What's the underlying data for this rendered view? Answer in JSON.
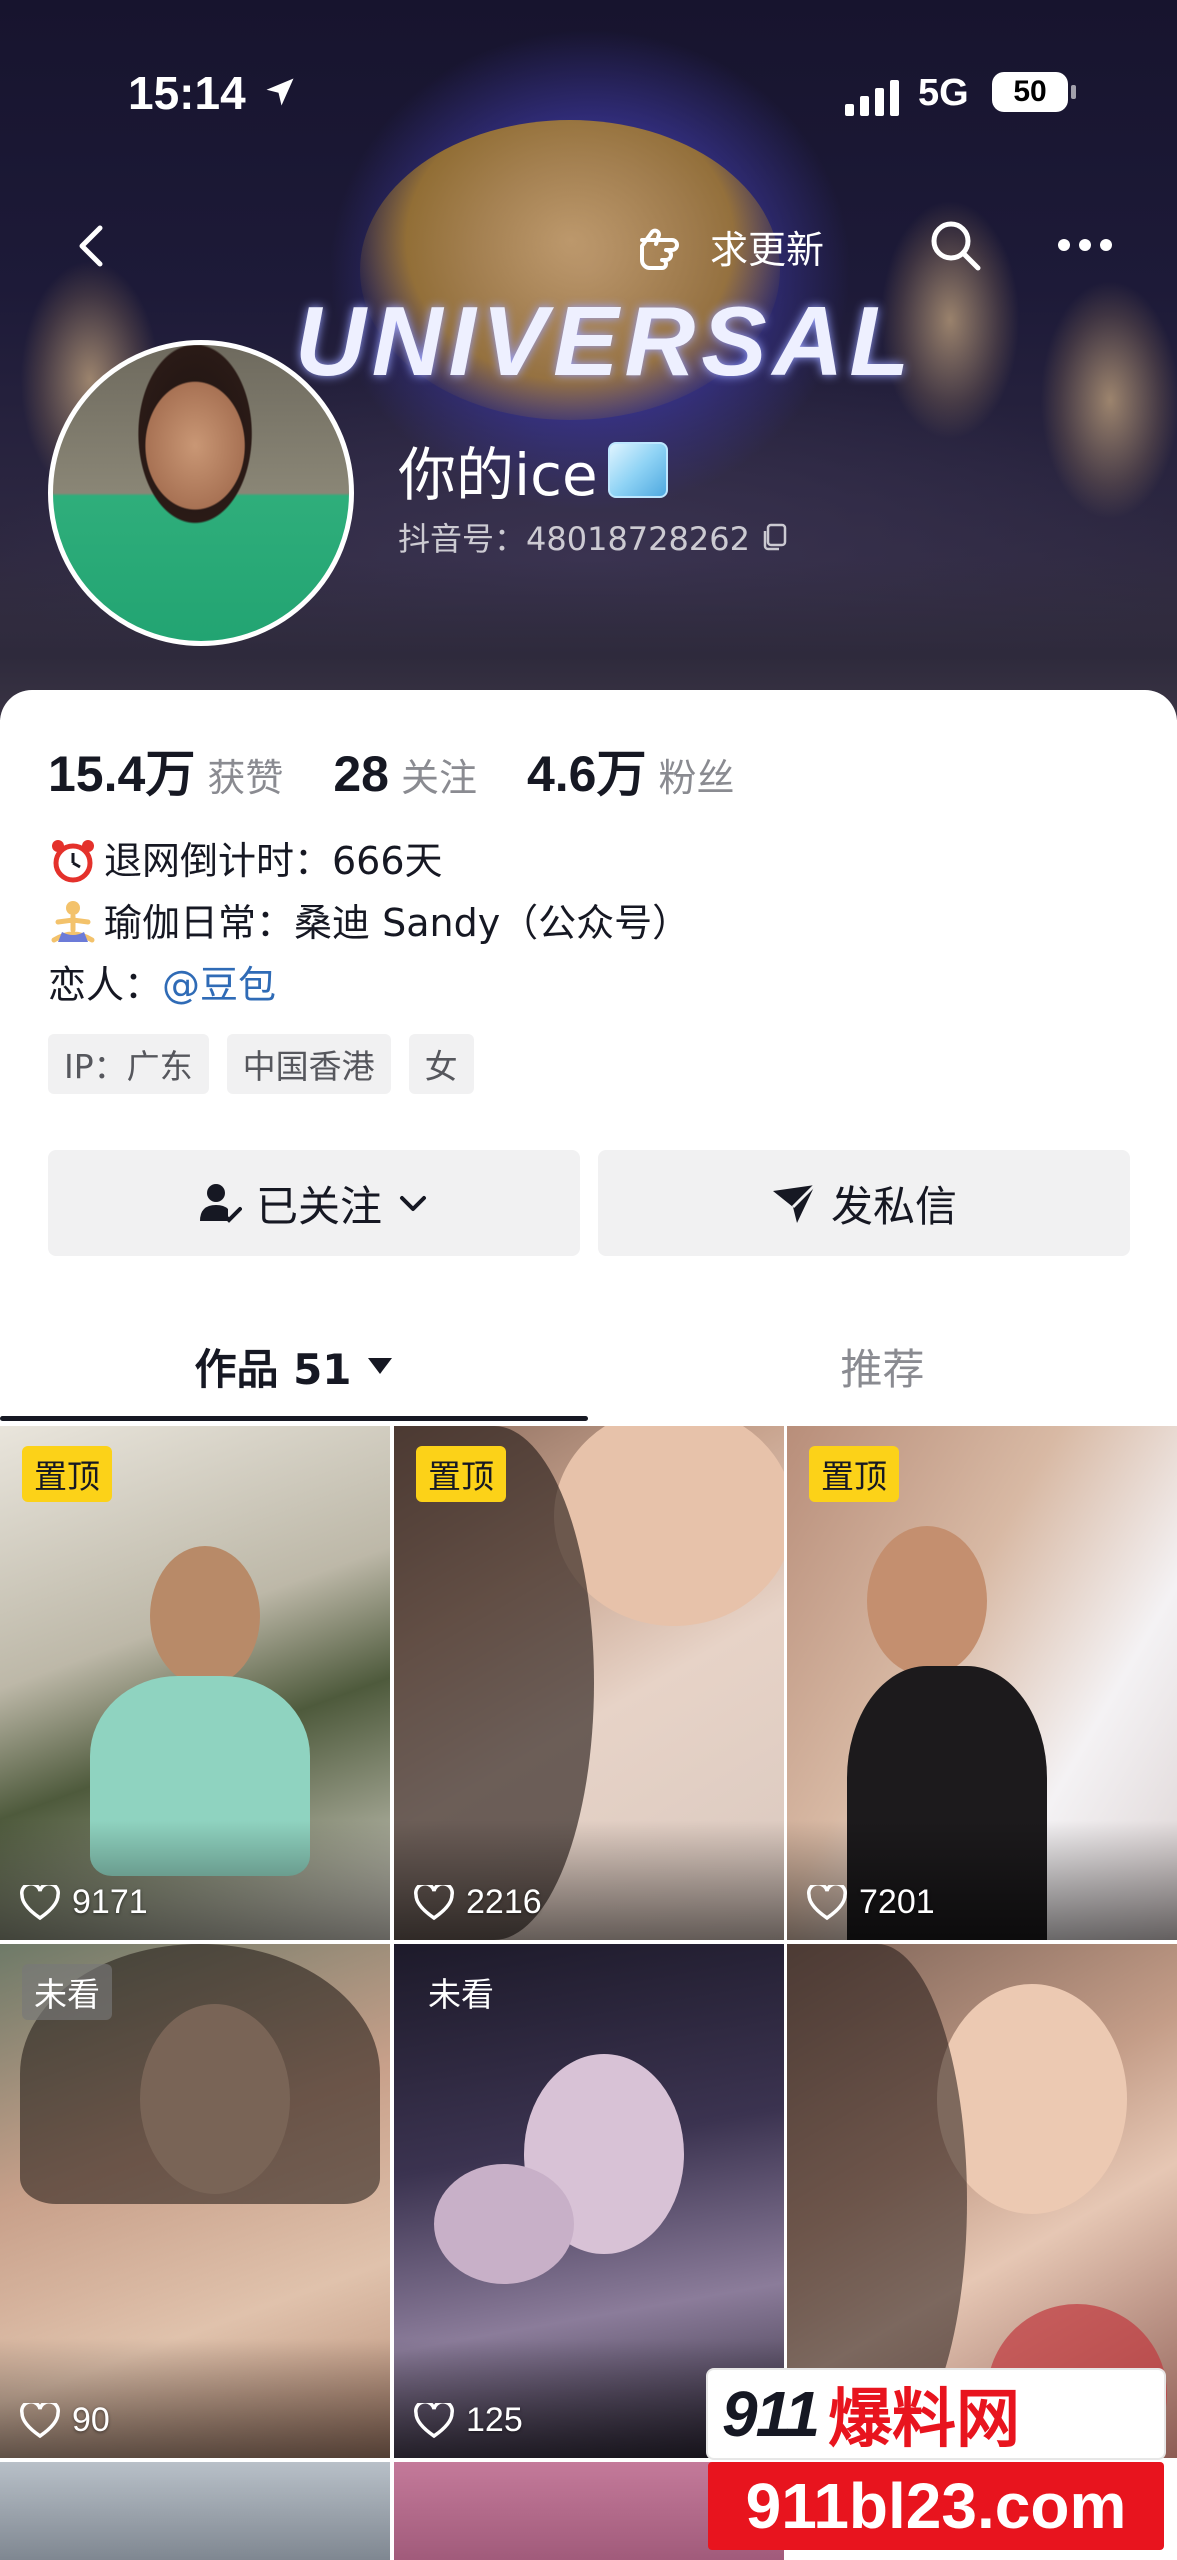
{
  "status_bar": {
    "time": "15:14",
    "network": "5G",
    "battery": "50"
  },
  "nav": {
    "update_label": "求更新"
  },
  "banner": {
    "sign_text": "UNIVERSAL"
  },
  "profile": {
    "nickname": "你的ice",
    "douyin_id": "抖音号：48018728262"
  },
  "stats": [
    {
      "num": "15.4万",
      "label": "获赞"
    },
    {
      "num": "28",
      "label": "关注"
    },
    {
      "num": "4.6万",
      "label": "粉丝"
    }
  ],
  "bio": {
    "line1": "退网倒计时：666天",
    "line2": "瑜伽日常：桑迪 Sandy（公众号）",
    "line3_prefix": "恋人：",
    "line3_mention": "@豆包"
  },
  "tags": [
    "IP：广东",
    "中国香港",
    "女"
  ],
  "actions": {
    "follow": "已关注",
    "message": "发私信"
  },
  "tabs": {
    "works": "作品 51",
    "recommend": "推荐"
  },
  "videos": [
    {
      "badge": "置顶",
      "badge_type": "pin",
      "likes": "9171"
    },
    {
      "badge": "置顶",
      "badge_type": "pin",
      "likes": "2216"
    },
    {
      "badge": "置顶",
      "badge_type": "pin",
      "likes": "7201"
    },
    {
      "badge": "未看",
      "badge_type": "unseen",
      "likes": "90"
    },
    {
      "badge": "未看",
      "badge_type": "unseen",
      "likes": "125"
    },
    {
      "badge": "",
      "badge_type": "none",
      "likes": ""
    }
  ],
  "watermark": {
    "top_num": "911",
    "top_cn": "爆料网",
    "url": "911bl23.com"
  },
  "colors": {
    "pin_badge": "#fcd218",
    "mention": "#2f6bb6",
    "watermark_red": "#e8141e"
  }
}
